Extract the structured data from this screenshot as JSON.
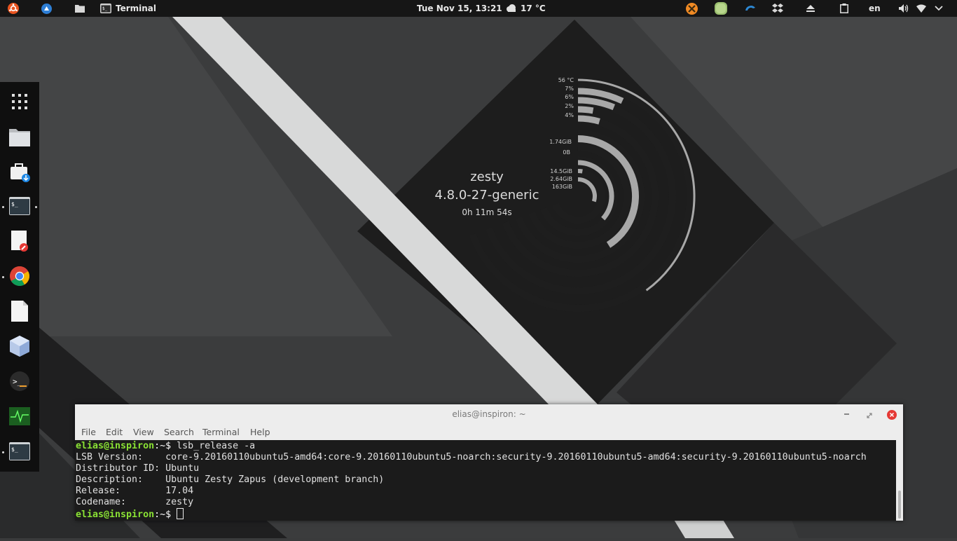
{
  "top_panel": {
    "app_name": "Terminal",
    "datetime": "Tue Nov 15, 13:21",
    "weather": "17 °C",
    "language": "en"
  },
  "dock": {
    "items": [
      "app-grid",
      "files",
      "software-store",
      "terminal-1",
      "text-editor",
      "chrome",
      "libreoffice-document",
      "virtualbox",
      "guake",
      "system-monitor",
      "terminal-2"
    ]
  },
  "conky": {
    "distro": "zesty",
    "kernel": "4.8.0-27-generic",
    "uptime": "0h 11m 54s",
    "cpu_temp": "56 °C",
    "cpu_cores": [
      "7%",
      "6%",
      "2%",
      "4%"
    ],
    "cpu_core_values": [
      7,
      6,
      2,
      4
    ],
    "memory": "1.74GiB",
    "swap": "0B",
    "disks": [
      "14.5GiB",
      "2.64GiB",
      "163GiB"
    ],
    "colors": {
      "arc": "#a8a8a8",
      "track": "#1e1e1e"
    }
  },
  "terminal": {
    "title": "elias@inspiron: ~",
    "menu": [
      "File",
      "Edit",
      "View",
      "Search",
      "Terminal",
      "Help"
    ],
    "prompt_user": "elias@inspiron",
    "prompt_suffix": ":~$ ",
    "command": "lsb_release -a",
    "output": [
      "LSB Version:    core-9.20160110ubuntu5-amd64:core-9.20160110ubuntu5-noarch:security-9.20160110ubuntu5-amd64:security-9.20160110ubuntu5-noarch",
      "Distributor ID: Ubuntu",
      "Description:    Ubuntu Zesty Zapus (development branch)",
      "Release:        17.04",
      "Codename:       zesty"
    ]
  }
}
